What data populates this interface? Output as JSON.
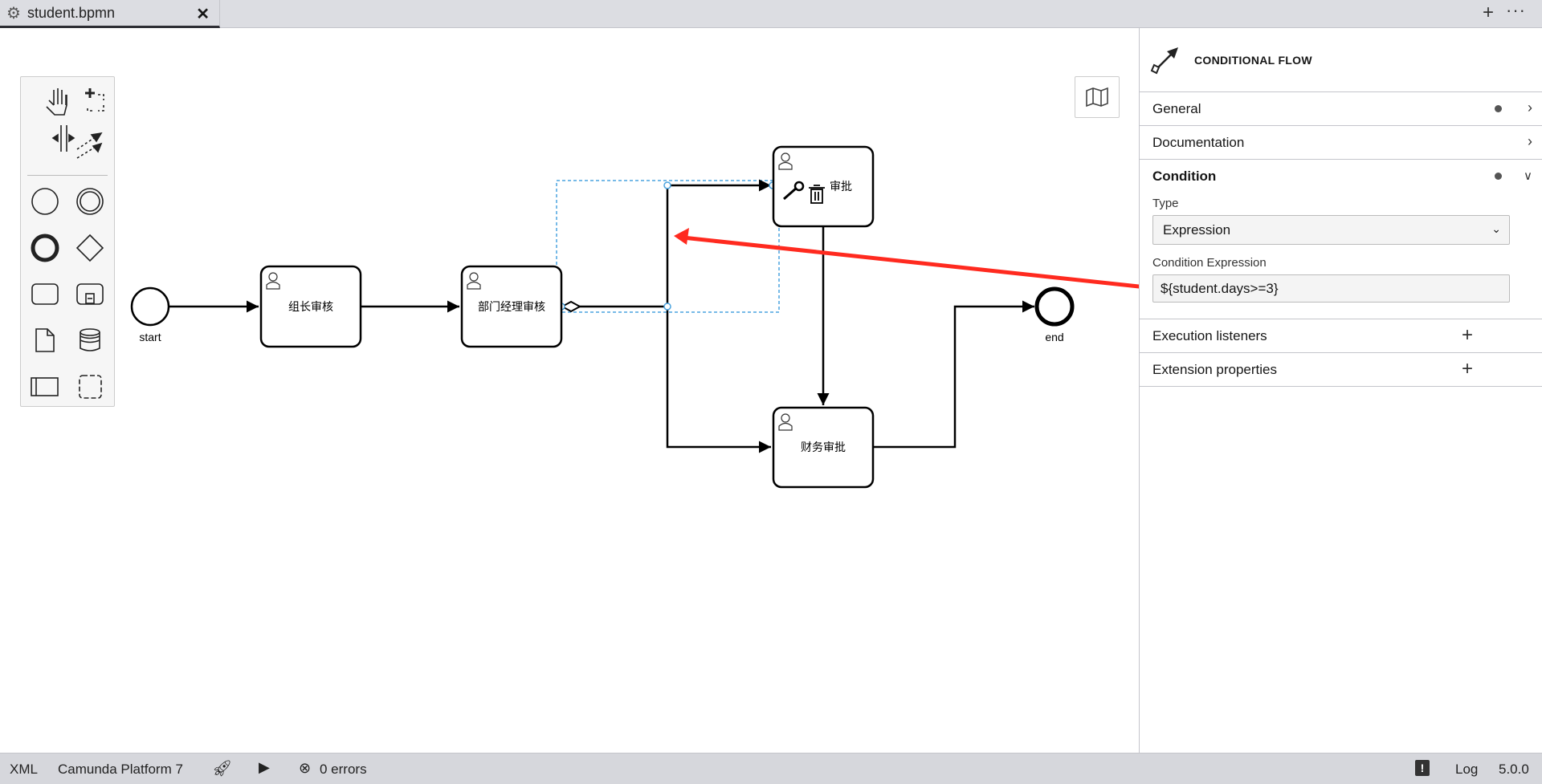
{
  "tab": {
    "name": "student.bpmn",
    "close": "✕",
    "gear_icon": "gear-icon"
  },
  "tabbar": {
    "plus": "+",
    "more": "···"
  },
  "diagram": {
    "start_label": "start",
    "end_label": "end",
    "tasks": [
      "组长审核",
      "部门经理审核",
      "审批",
      "财务审批"
    ]
  },
  "panel": {
    "title": "CONDITIONAL FLOW",
    "sections": {
      "general": "General",
      "documentation": "Documentation",
      "condition": "Condition",
      "execution_listeners": "Execution listeners",
      "extension_properties": "Extension properties"
    },
    "type_label": "Type",
    "type_value": "Expression",
    "expr_label": "Condition Expression",
    "expr_value": "${student.days>=3}"
  },
  "status": {
    "xml": "XML",
    "platform": "Camunda Platform 7",
    "errors": "0 errors",
    "log": "Log",
    "version": "5.0.0"
  },
  "colors": {
    "selection": "#4aa3df",
    "annotation_arrow": "#ff2a1f"
  }
}
